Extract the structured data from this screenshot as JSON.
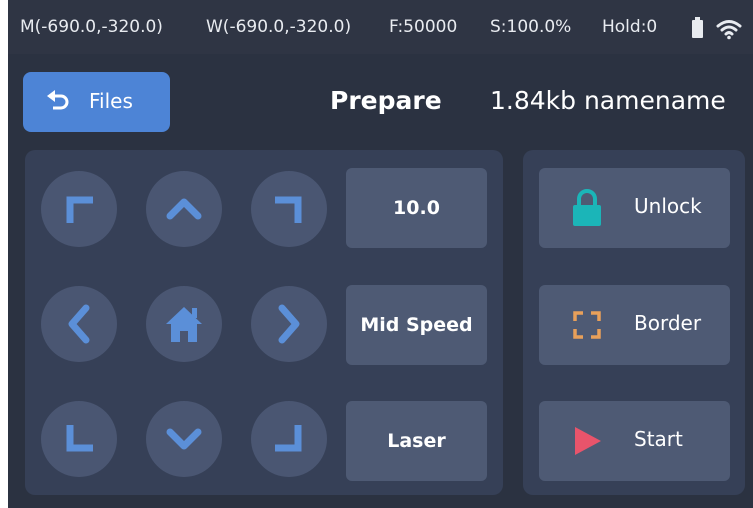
{
  "status_bar": {
    "machine_pos": "M(-690.0,-320.0)",
    "work_pos": "W(-690.0,-320.0)",
    "feed": "F:50000",
    "speed": "S:100.0%",
    "hold": "Hold:0",
    "icons": [
      "battery-icon",
      "wifi-icon"
    ]
  },
  "header": {
    "files_button": "Files",
    "title": "Prepare",
    "file_info": "1.84kb namename"
  },
  "jog": {
    "buttons": [
      "jog-up-left",
      "jog-up",
      "jog-up-right",
      "jog-left",
      "jog-home",
      "jog-right",
      "jog-down-left",
      "jog-down",
      "jog-down-right"
    ],
    "step_value": "10.0",
    "speed_mode": "Mid Speed",
    "tool_mode": "Laser"
  },
  "actions": {
    "unlock": "Unlock",
    "border": "Border",
    "start": "Start"
  },
  "colors": {
    "background": "#2b3241",
    "panel": "#364057",
    "button": "#4e5a74",
    "jog_button": "#4a5672",
    "accent_blue": "#4d84d6",
    "arrow_blue": "#5b8fd8",
    "unlock_teal": "#1bb5b8",
    "border_orange": "#e8a05a",
    "start_red": "#e8546b"
  }
}
